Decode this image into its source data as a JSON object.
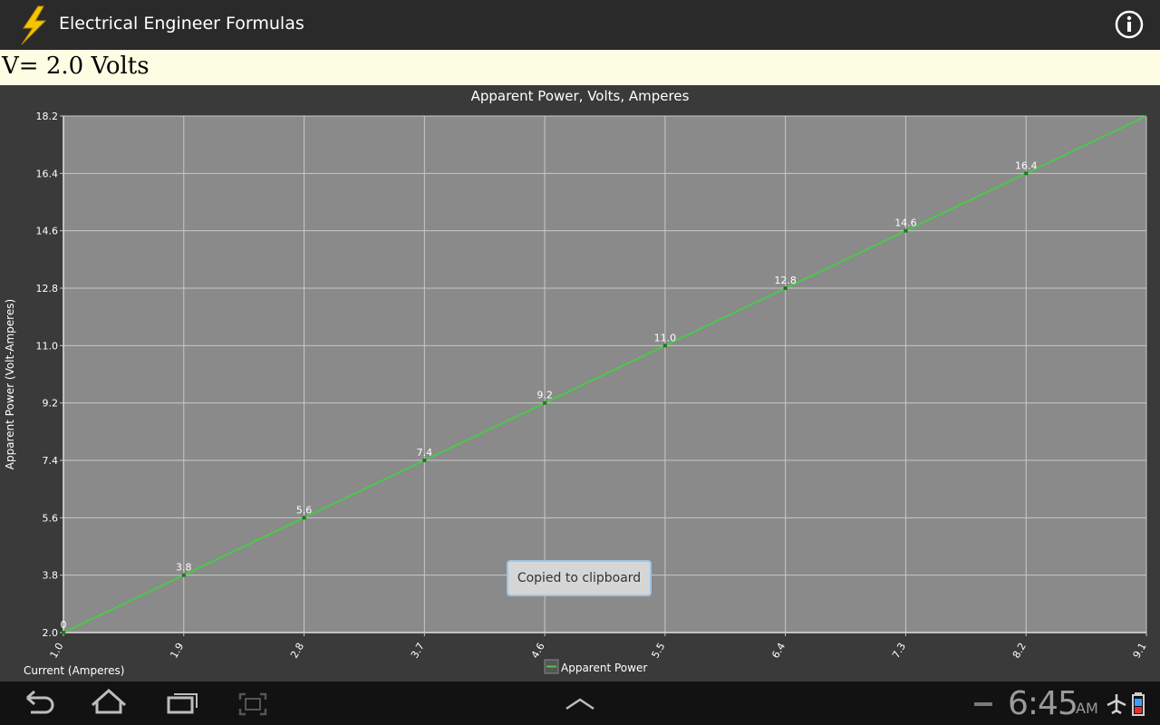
{
  "app": {
    "title": "Electrical Engineer Formulas"
  },
  "voltage_readout": "V= 2.0 Volts",
  "toast": "Copied to clipboard",
  "chart_data": {
    "type": "line",
    "title": "Apparent Power, Volts, Amperes",
    "xlabel": "Current (Amperes)",
    "ylabel": "Apparent Power (Volt-Amperes)",
    "x_ticks": [
      "1.0",
      "1.9",
      "2.8",
      "3.7",
      "4.6",
      "5.5",
      "6.4",
      "7.3",
      "8.2",
      "9.1"
    ],
    "y_ticks": [
      "2.0",
      "3.8",
      "5.6",
      "7.4",
      "9.2",
      "11.0",
      "12.8",
      "14.6",
      "16.4",
      "18.2"
    ],
    "xlim": [
      1.0,
      9.1
    ],
    "ylim": [
      2.0,
      18.2
    ],
    "grid": true,
    "legend_position": "bottom-center",
    "series": [
      {
        "name": "Apparent Power",
        "color": "#4bc84b",
        "x": [
          1.0,
          1.9,
          2.8,
          3.7,
          4.6,
          5.5,
          6.4,
          7.3,
          8.2
        ],
        "y": [
          2.0,
          3.8,
          5.6,
          7.4,
          9.2,
          11.0,
          12.8,
          14.6,
          16.4
        ],
        "labels": [
          "0",
          "3.8",
          "5.6",
          "7.4",
          "9.2",
          "11.0",
          "12.8",
          "14.6",
          "16.4"
        ]
      }
    ]
  },
  "status": {
    "time": "6:45",
    "ampm": "AM"
  },
  "icons": {
    "app": "lightning-bolt-icon",
    "info": "info-icon",
    "back": "back-icon",
    "home": "home-icon",
    "recent": "recent-apps-icon",
    "screenshot": "screenshot-icon",
    "up": "chevron-up-icon",
    "airplane": "airplane-icon",
    "battery": "battery-icon"
  }
}
